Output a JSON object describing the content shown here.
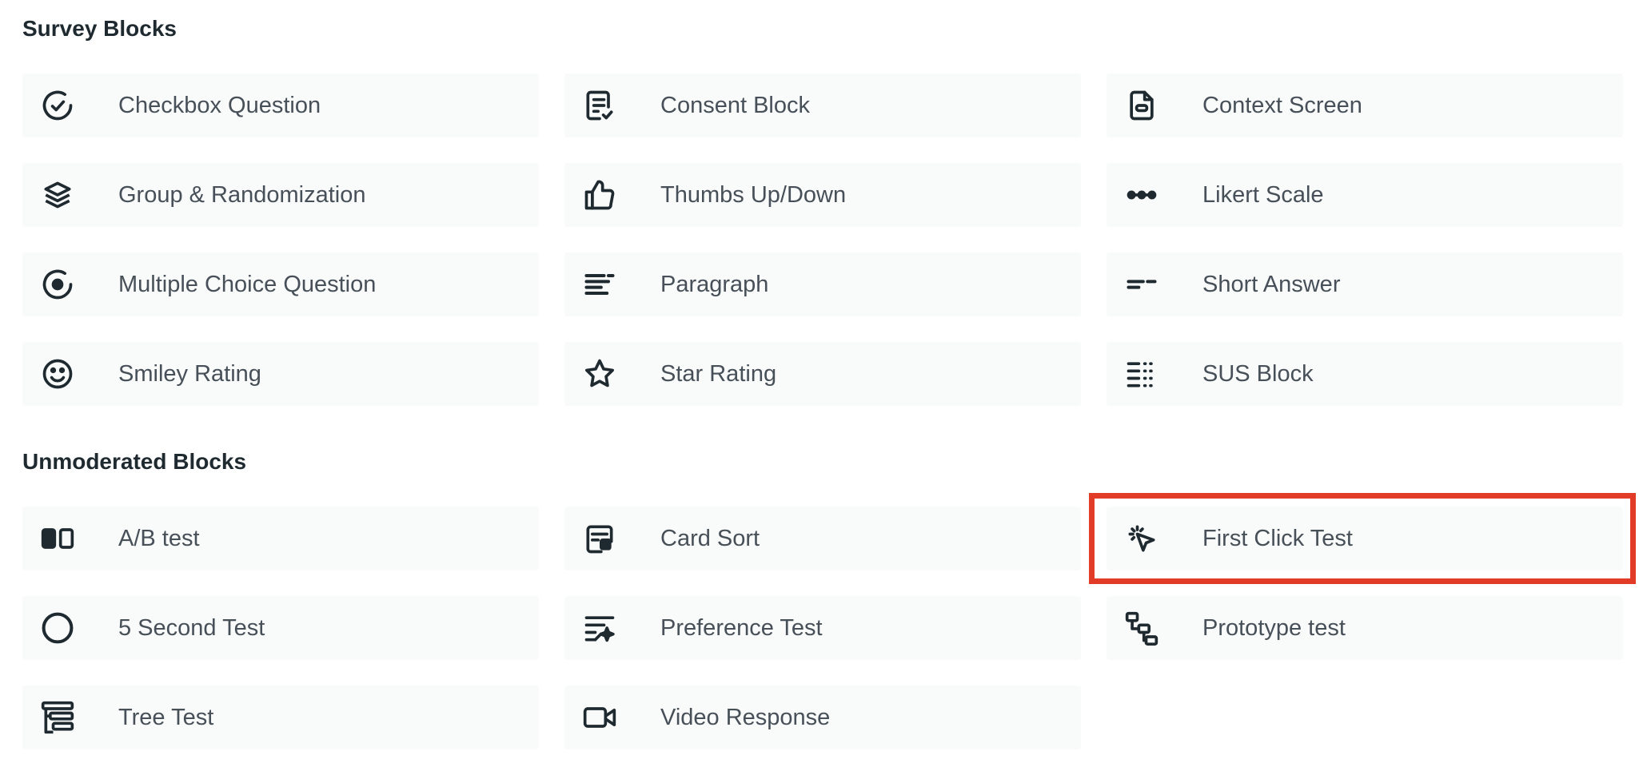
{
  "sections": [
    {
      "title": "Survey Blocks",
      "items": [
        {
          "label": "Checkbox Question",
          "icon": "check-circle-icon"
        },
        {
          "label": "Consent Block",
          "icon": "document-check-icon"
        },
        {
          "label": "Context Screen",
          "icon": "file-icon"
        },
        {
          "label": "Group & Randomization",
          "icon": "layers-icon"
        },
        {
          "label": "Thumbs Up/Down",
          "icon": "thumbs-up-icon"
        },
        {
          "label": "Likert Scale",
          "icon": "dots-line-icon"
        },
        {
          "label": "Multiple Choice Question",
          "icon": "radio-icon"
        },
        {
          "label": "Paragraph",
          "icon": "paragraph-icon"
        },
        {
          "label": "Short Answer",
          "icon": "short-answer-icon"
        },
        {
          "label": "Smiley Rating",
          "icon": "smiley-icon"
        },
        {
          "label": "Star Rating",
          "icon": "star-icon"
        },
        {
          "label": "SUS Block",
          "icon": "sus-list-icon"
        }
      ]
    },
    {
      "title": "Unmoderated Blocks",
      "items": [
        {
          "label": "A/B test",
          "icon": "ab-test-icon"
        },
        {
          "label": "Card Sort",
          "icon": "card-sort-icon"
        },
        {
          "label": "First Click Test",
          "icon": "cursor-click-icon"
        },
        {
          "label": "5 Second Test",
          "icon": "circle-icon"
        },
        {
          "label": "Preference Test",
          "icon": "sparkle-list-icon"
        },
        {
          "label": "Prototype test",
          "icon": "flow-icon"
        },
        {
          "label": "Tree Test",
          "icon": "tree-icon"
        },
        {
          "label": "Video Response",
          "icon": "video-icon"
        }
      ]
    }
  ],
  "highlighted_item": "First Click Test",
  "colors": {
    "highlight": "#e23b27",
    "tile_bg": "#f9fafa",
    "text": "#475058",
    "heading": "#1f2a30"
  }
}
